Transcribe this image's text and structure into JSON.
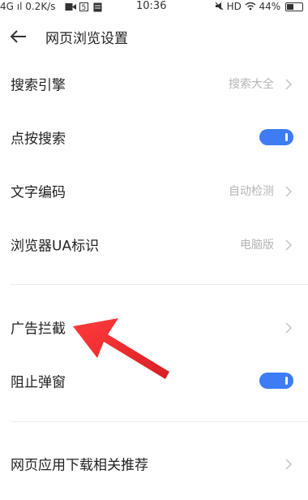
{
  "status_bar": {
    "left": "4G ıl  0.2K/s",
    "time": "10:36",
    "right_hd": "HD",
    "battery": "44%",
    "battery_level": 0.44
  },
  "header": {
    "title": "网页浏览设置"
  },
  "settings": {
    "search_engine": {
      "label": "搜索引擎",
      "value": "搜索大全"
    },
    "tap_search": {
      "label": "点按搜索",
      "enabled": true
    },
    "text_encoding": {
      "label": "文字编码",
      "value": "自动检测"
    },
    "browser_ua": {
      "label": "浏览器UA标识",
      "value": "电脑版"
    },
    "ad_block": {
      "label": "广告拦截"
    },
    "block_popups": {
      "label": "阻止弹窗",
      "enabled": true
    },
    "web_app_recommend": {
      "label": "网页应用下载相关推荐"
    }
  },
  "colors": {
    "toggle_on": "#3d7cf5",
    "annotation_arrow": "#e8242a"
  }
}
